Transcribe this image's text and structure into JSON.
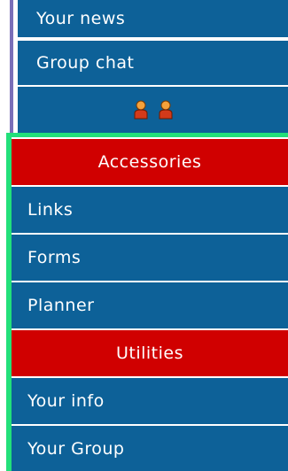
{
  "menu_top": {
    "items": [
      {
        "label": "Your news"
      },
      {
        "label": "Group chat"
      }
    ],
    "online_users_icons": [
      "user-icon",
      "user-icon"
    ]
  },
  "accessories": {
    "header": "Accessories",
    "items": [
      {
        "label": "Links"
      },
      {
        "label": "Forms"
      },
      {
        "label": "Planner"
      }
    ]
  },
  "utilities": {
    "header": "Utilities",
    "items": [
      {
        "label": "Your info"
      },
      {
        "label": "Your Group"
      }
    ]
  },
  "colors": {
    "item_bg": "#0d6198",
    "header_bg": "#d00000",
    "frame_green": "#22e07a",
    "frame_purple": "#7a70b8"
  }
}
